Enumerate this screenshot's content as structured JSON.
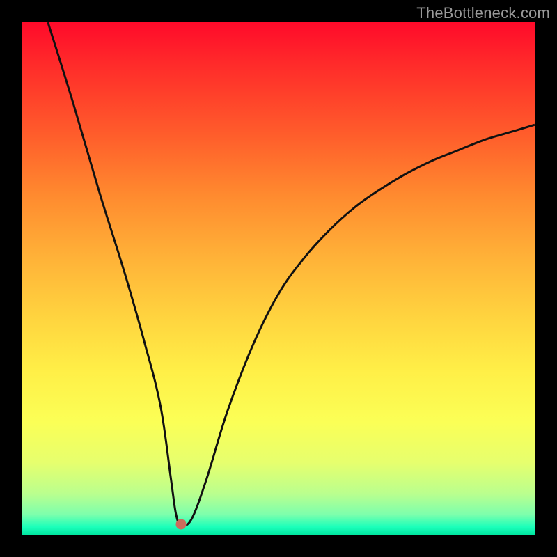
{
  "watermark": "TheBottleneck.com",
  "colors": {
    "frame": "#000000",
    "curve_stroke": "#111111",
    "dot_fill": "#cc6b5c"
  },
  "chart_data": {
    "type": "line",
    "title": "",
    "xlabel": "",
    "ylabel": "",
    "xlim": [
      0,
      100
    ],
    "ylim": [
      0,
      100
    ],
    "annotations": [
      {
        "name": "minimum-marker",
        "x": 31,
        "y": 2
      }
    ],
    "series": [
      {
        "name": "bottleneck-curve",
        "x": [
          5,
          10,
          15,
          20,
          24,
          27,
          29,
          30,
          31,
          33,
          36,
          40,
          45,
          50,
          55,
          60,
          65,
          70,
          75,
          80,
          85,
          90,
          95,
          100
        ],
        "y": [
          100,
          84,
          67,
          51,
          37,
          25,
          11,
          4,
          2,
          3,
          11,
          24,
          37,
          47,
          54,
          59.5,
          64,
          67.5,
          70.5,
          73,
          75,
          77,
          78.5,
          80
        ]
      }
    ],
    "gradient_bands": [
      {
        "label": "red",
        "approx_y_range": [
          70,
          100
        ]
      },
      {
        "label": "orange",
        "approx_y_range": [
          40,
          70
        ]
      },
      {
        "label": "yellow",
        "approx_y_range": [
          15,
          40
        ]
      },
      {
        "label": "green",
        "approx_y_range": [
          0,
          15
        ]
      }
    ]
  }
}
